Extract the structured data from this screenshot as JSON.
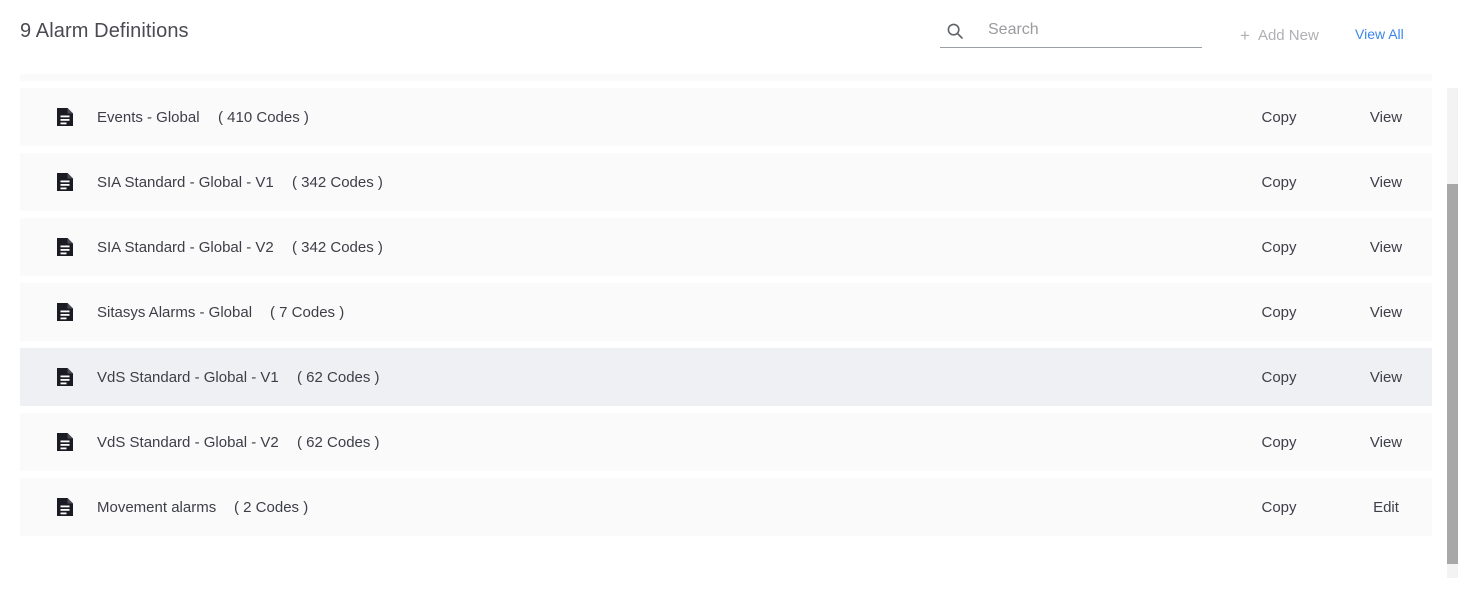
{
  "header": {
    "title": "9 Alarm Definitions",
    "search": {
      "placeholder": "Search",
      "value": "",
      "icon": "search-icon"
    },
    "add_new": {
      "plus": "+",
      "label": "Add New"
    },
    "view_all_label": "View All"
  },
  "list": {
    "row_icon": "document-icon",
    "rows": [
      {
        "name": "Events - Global",
        "count": "( 410 Codes )",
        "copy": "Copy",
        "action": "View",
        "selected": false
      },
      {
        "name": "SIA Standard - Global - V1",
        "count": "( 342 Codes )",
        "copy": "Copy",
        "action": "View",
        "selected": false
      },
      {
        "name": "SIA Standard - Global - V2",
        "count": "( 342 Codes )",
        "copy": "Copy",
        "action": "View",
        "selected": false
      },
      {
        "name": "Sitasys Alarms - Global",
        "count": "( 7 Codes )",
        "copy": "Copy",
        "action": "View",
        "selected": false
      },
      {
        "name": "VdS Standard - Global - V1",
        "count": "( 62 Codes )",
        "copy": "Copy",
        "action": "View",
        "selected": true
      },
      {
        "name": "VdS Standard - Global - V2",
        "count": "( 62 Codes )",
        "copy": "Copy",
        "action": "View",
        "selected": false
      },
      {
        "name": "Movement alarms",
        "count": "( 2 Codes )",
        "copy": "Copy",
        "action": "Edit",
        "selected": false
      }
    ]
  },
  "colors": {
    "link_blue": "#3c87e8",
    "row_background": "#fafafa",
    "row_selected_background": "#eef0f4",
    "text": "#3e3e48",
    "muted": "#b0b0b4",
    "scrollbar_thumb": "#a8a8a8"
  }
}
